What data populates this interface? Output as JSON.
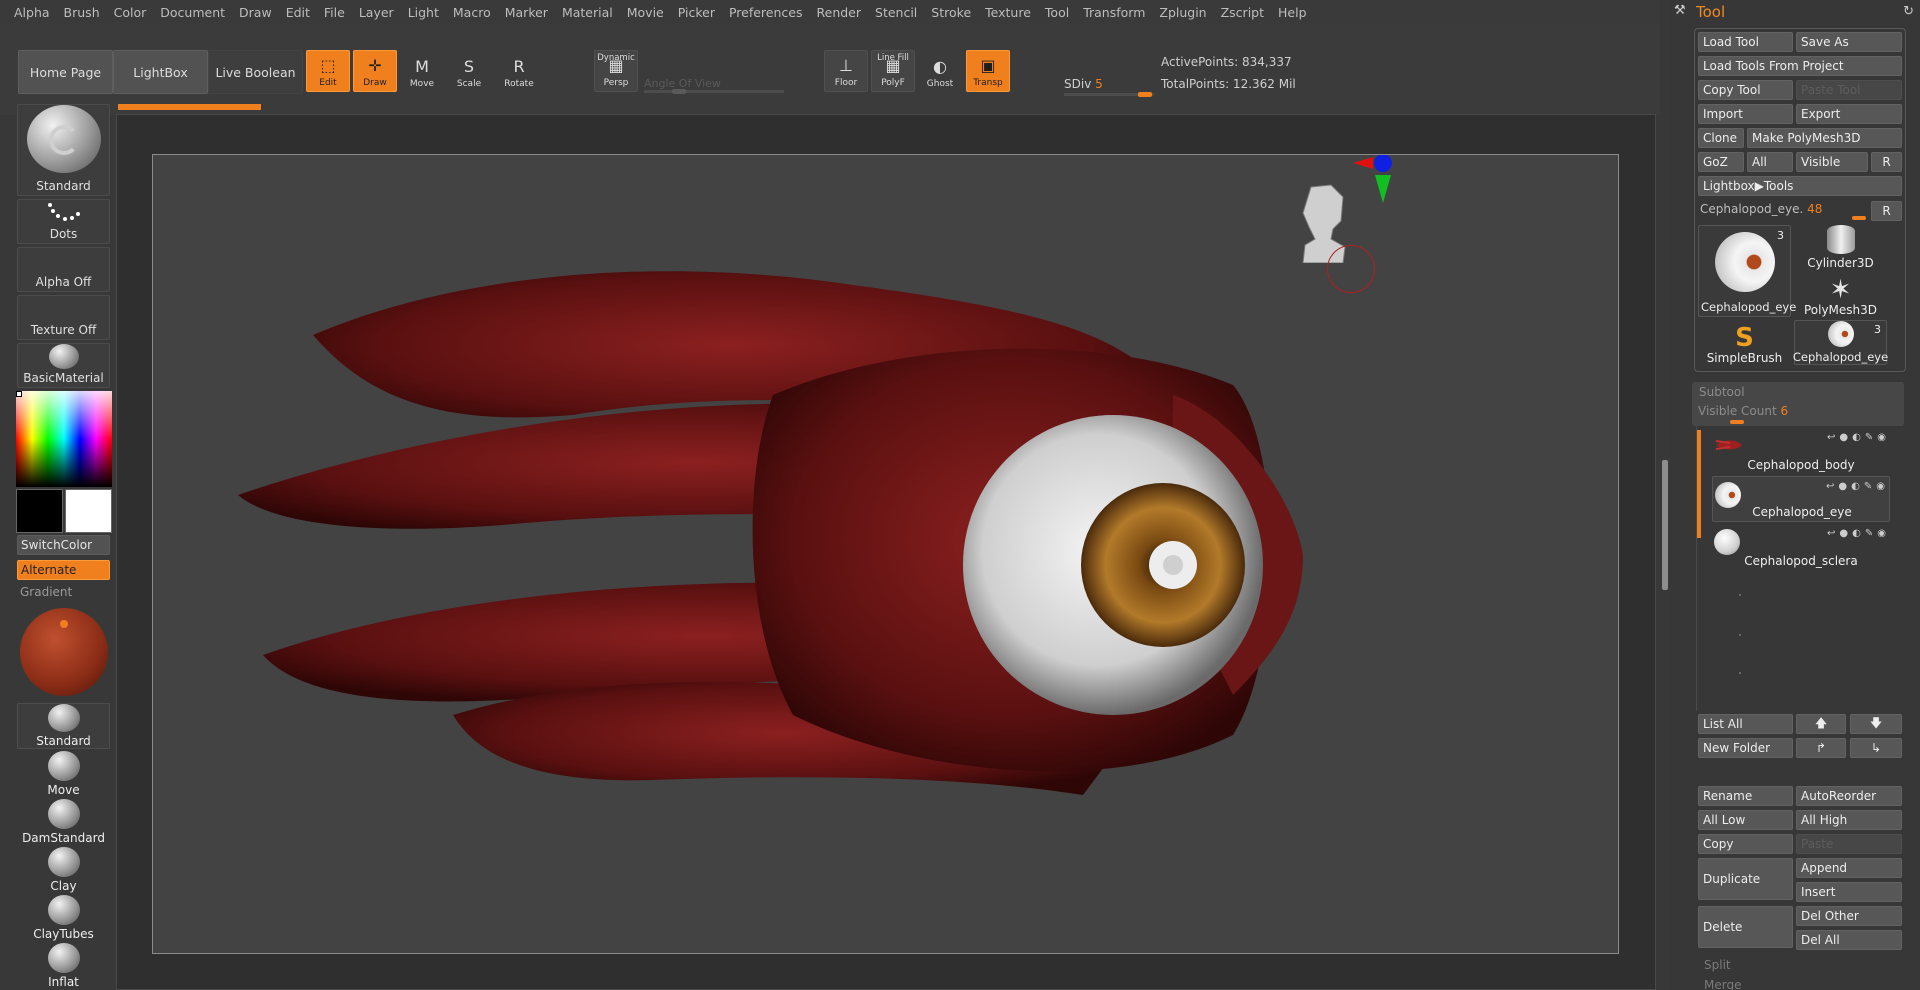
{
  "menu": [
    "Alpha",
    "Brush",
    "Color",
    "Document",
    "Draw",
    "Edit",
    "File",
    "Layer",
    "Light",
    "Macro",
    "Marker",
    "Material",
    "Movie",
    "Picker",
    "Preferences",
    "Render",
    "Stencil",
    "Stroke",
    "Texture",
    "Tool",
    "Transform",
    "Zplugin",
    "Zscript",
    "Help"
  ],
  "toolbar": {
    "home_page": "Home Page",
    "lightbox": "LightBox",
    "live_boolean": "Live Boolean",
    "edit": "Edit",
    "draw": "Draw",
    "move": "Move",
    "scale": "Scale",
    "rotate": "Rotate",
    "dynamic": "Dynamic",
    "persp": "Persp",
    "angle_of_view": "Angle Of View",
    "floor": "Floor",
    "line_fill": "Line Fill",
    "polyf": "PolyF",
    "ghost": "Ghost",
    "transp": "Transp",
    "sdiv_label": "SDiv",
    "sdiv_value": "5",
    "active_points": "ActivePoints: 834,337",
    "total_points": "TotalPoints: 12.362 Mil"
  },
  "left_shelf": {
    "brush": "Standard",
    "stroke": "Dots",
    "alpha": "Alpha Off",
    "texture": "Texture Off",
    "material": "BasicMaterial",
    "switch_color": "SwitchColor",
    "alternate": "Alternate",
    "gradient": "Gradient",
    "brushes": [
      "Standard",
      "Move",
      "DamStandard",
      "Clay",
      "ClayTubes",
      "Inflat"
    ]
  },
  "tool_panel": {
    "title": "Tool",
    "load_tool": "Load Tool",
    "save_as": "Save As",
    "load_from_project": "Load Tools From Project",
    "copy_tool": "Copy Tool",
    "paste_tool": "Paste Tool",
    "import": "Import",
    "export": "Export",
    "clone": "Clone",
    "make_polymesh": "Make PolyMesh3D",
    "goz": "GoZ",
    "all": "All",
    "visible": "Visible",
    "r": "R",
    "lightbox_tools": "Lightbox▶Tools",
    "current_tool": "Cephalopod_eye.",
    "current_tool_value": "48",
    "thumbs": {
      "main_name": "Cephalopod_eye",
      "main_count": "3",
      "cylinder": "Cylinder3D",
      "polymesh": "PolyMesh3D",
      "simplebrush": "SimpleBrush",
      "small_eye": "Cephalopod_eye",
      "small_count": "3"
    },
    "subtool": "Subtool",
    "visible_count_label": "Visible Count",
    "visible_count": "6",
    "subtools": [
      "Cephalopod_body",
      "Cephalopod_eye",
      "Cephalopod_sclera"
    ],
    "list_all": "List All",
    "new_folder": "New Folder",
    "rename": "Rename",
    "autoreorder": "AutoReorder",
    "all_low": "All Low",
    "all_high": "All High",
    "copy": "Copy",
    "paste": "Paste",
    "duplicate": "Duplicate",
    "append": "Append",
    "insert": "Insert",
    "delete": "Delete",
    "del_other": "Del Other",
    "del_all": "Del All",
    "split": "Split",
    "merge": "Merge"
  },
  "colors": {
    "accent": "#f0801d",
    "panel": "#373737",
    "button": "#575757"
  }
}
